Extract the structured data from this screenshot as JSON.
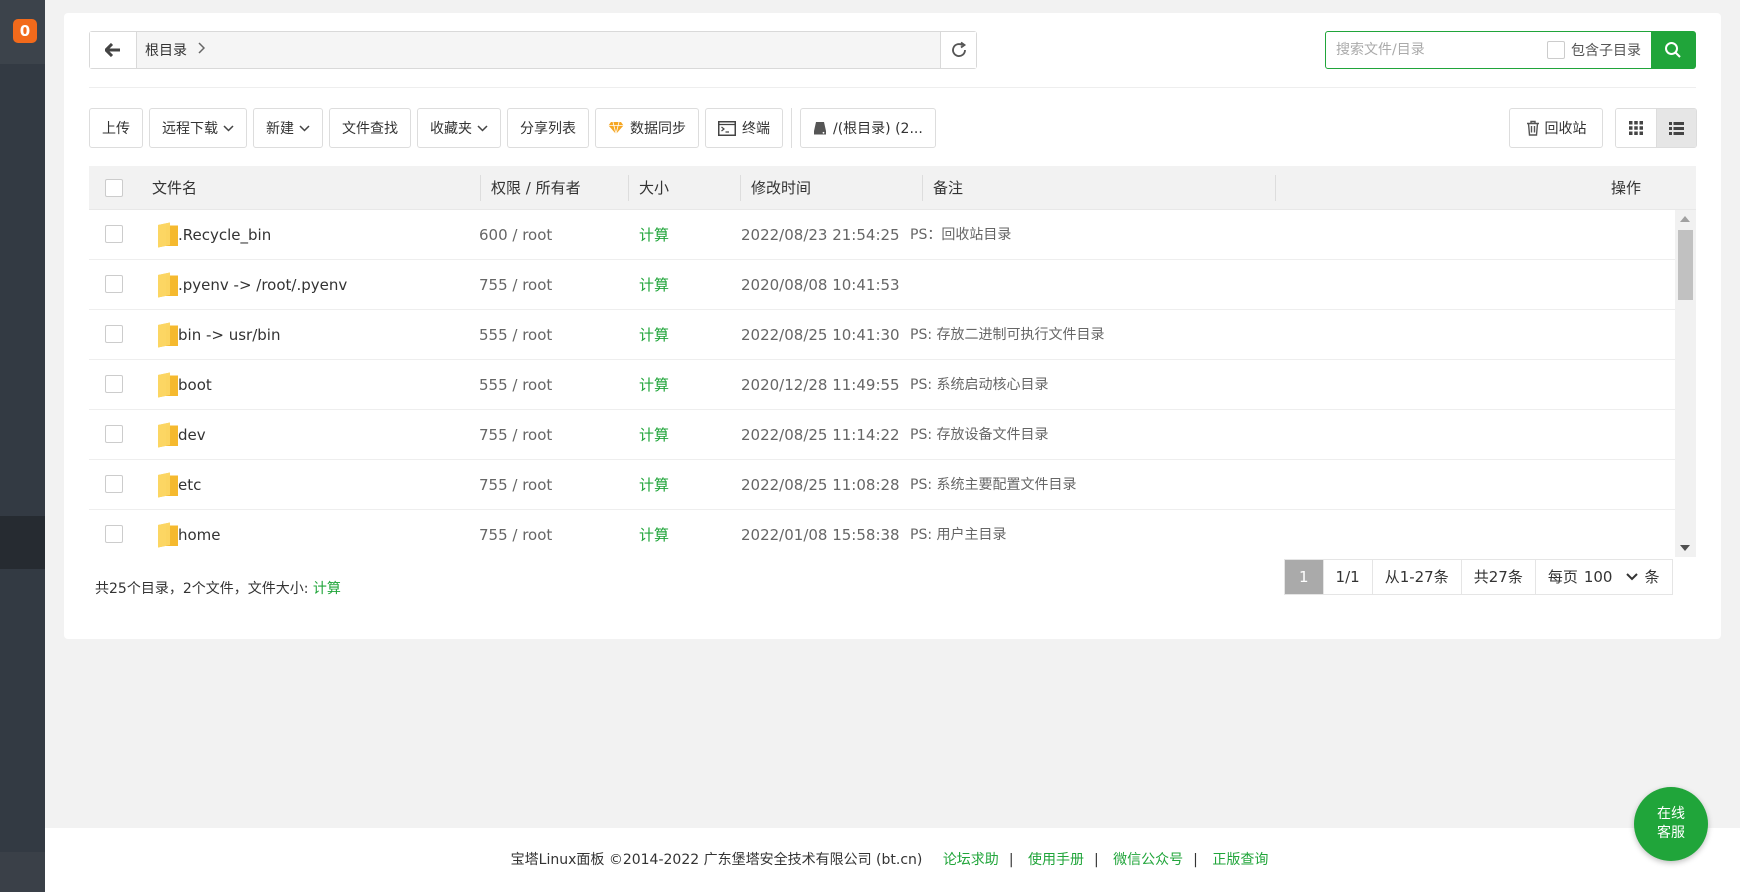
{
  "sidebar": {
    "badge": "0"
  },
  "pathbar": {
    "path_label": "根目录"
  },
  "search": {
    "placeholder": "搜索文件/目录",
    "include_sub_label": "包含子目录"
  },
  "toolbar": {
    "upload": "上传",
    "remote_download": "远程下载",
    "new": "新建",
    "file_search": "文件查找",
    "favorites": "收藏夹",
    "share_list": "分享列表",
    "data_sync": "数据同步",
    "terminal": "终端",
    "disk": "/(根目录) (2...",
    "recycle_bin": "回收站"
  },
  "table": {
    "headers": {
      "name": "文件名",
      "perm": "权限 / 所有者",
      "size": "大小",
      "mtime": "修改时间",
      "note": "备注",
      "ops": "操作"
    },
    "rows": [
      {
        "name": ".Recycle_bin",
        "perm": "600 / root",
        "size": "计算",
        "mtime": "2022/08/23 21:54:25",
        "note": "PS：回收站目录"
      },
      {
        "name": ".pyenv -> /root/.pyenv",
        "perm": "755 / root",
        "size": "计算",
        "mtime": "2020/08/08 10:41:53",
        "note": ""
      },
      {
        "name": "bin -> usr/bin",
        "perm": "555 / root",
        "size": "计算",
        "mtime": "2022/08/25 10:41:30",
        "note": "PS: 存放二进制可执行文件目录"
      },
      {
        "name": "boot",
        "perm": "555 / root",
        "size": "计算",
        "mtime": "2020/12/28 11:49:55",
        "note": "PS: 系统启动核心目录"
      },
      {
        "name": "dev",
        "perm": "755 / root",
        "size": "计算",
        "mtime": "2022/08/25 11:14:22",
        "note": "PS: 存放设备文件目录"
      },
      {
        "name": "etc",
        "perm": "755 / root",
        "size": "计算",
        "mtime": "2022/08/25 11:08:28",
        "note": "PS: 系统主要配置文件目录"
      },
      {
        "name": "home",
        "perm": "755 / root",
        "size": "计算",
        "mtime": "2022/01/08 15:58:38",
        "note": "PS: 用户主目录"
      }
    ]
  },
  "summary": {
    "text": "共25个目录，2个文件，文件大小: ",
    "calc": "计算"
  },
  "pager": {
    "current": "1",
    "pages": "1/1",
    "range": "从1-27条",
    "total": "共27条",
    "per_page_label": "每页",
    "per_page_value": "100",
    "unit": "条"
  },
  "footer": {
    "copyright": "宝塔Linux面板 ©2014-2022 广东堡塔安全技术有限公司 (bt.cn)",
    "links": [
      "论坛求助",
      "使用手册",
      "微信公众号",
      "正版查询"
    ],
    "separator": "|"
  },
  "chat": {
    "line1": "在线",
    "line2": "客服"
  },
  "colors": {
    "accent": "#20a53a",
    "sidebar": "#333a43",
    "badge": "#f26a1b"
  }
}
